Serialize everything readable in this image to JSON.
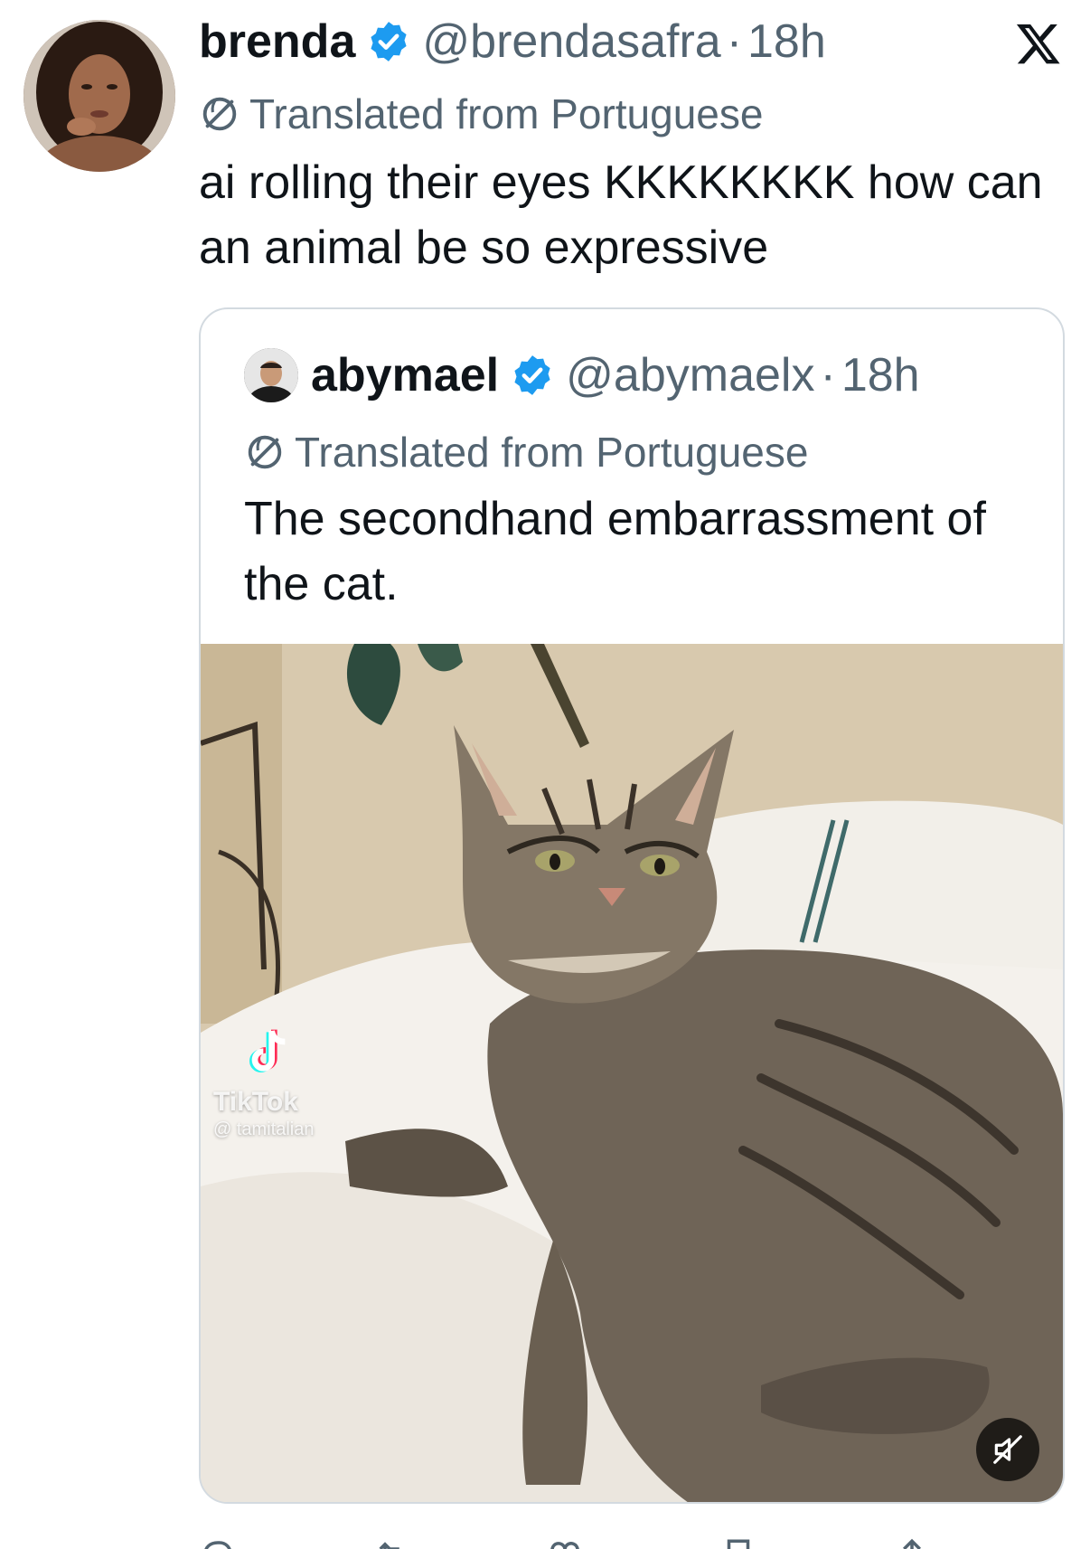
{
  "tweet": {
    "author": {
      "display_name": "brenda",
      "handle": "@brendasafra",
      "separator": "·",
      "time": "18h"
    },
    "translated_label": "Translated from Portuguese",
    "text": "ai rolling their eyes KKKKKKKK how can an animal be so expressive",
    "icons": {
      "verified": "verified-badge-icon",
      "platform": "x-logo-icon",
      "translate": "translate-globe-icon"
    }
  },
  "quote": {
    "author": {
      "display_name": "abymael",
      "handle": "@abymaelx",
      "separator": "·",
      "time": "18h"
    },
    "translated_label": "Translated from Portuguese",
    "text": "The secondhand embarrassment of the cat.",
    "media": {
      "type": "video",
      "watermark_brand": "TikTok",
      "watermark_user": "@ tamitalian",
      "muted": true
    }
  },
  "actions": [
    {
      "icon": "reply-icon",
      "count": ""
    },
    {
      "icon": "retweet-icon",
      "count": ""
    },
    {
      "icon": "like-icon",
      "count": ""
    },
    {
      "icon": "bookmark-icon",
      "count": ""
    },
    {
      "icon": "share-icon",
      "count": ""
    }
  ],
  "colors": {
    "text_primary": "#0f1419",
    "text_secondary": "#536471",
    "verified_blue": "#1d9bf0",
    "card_border": "#d3dae0"
  }
}
